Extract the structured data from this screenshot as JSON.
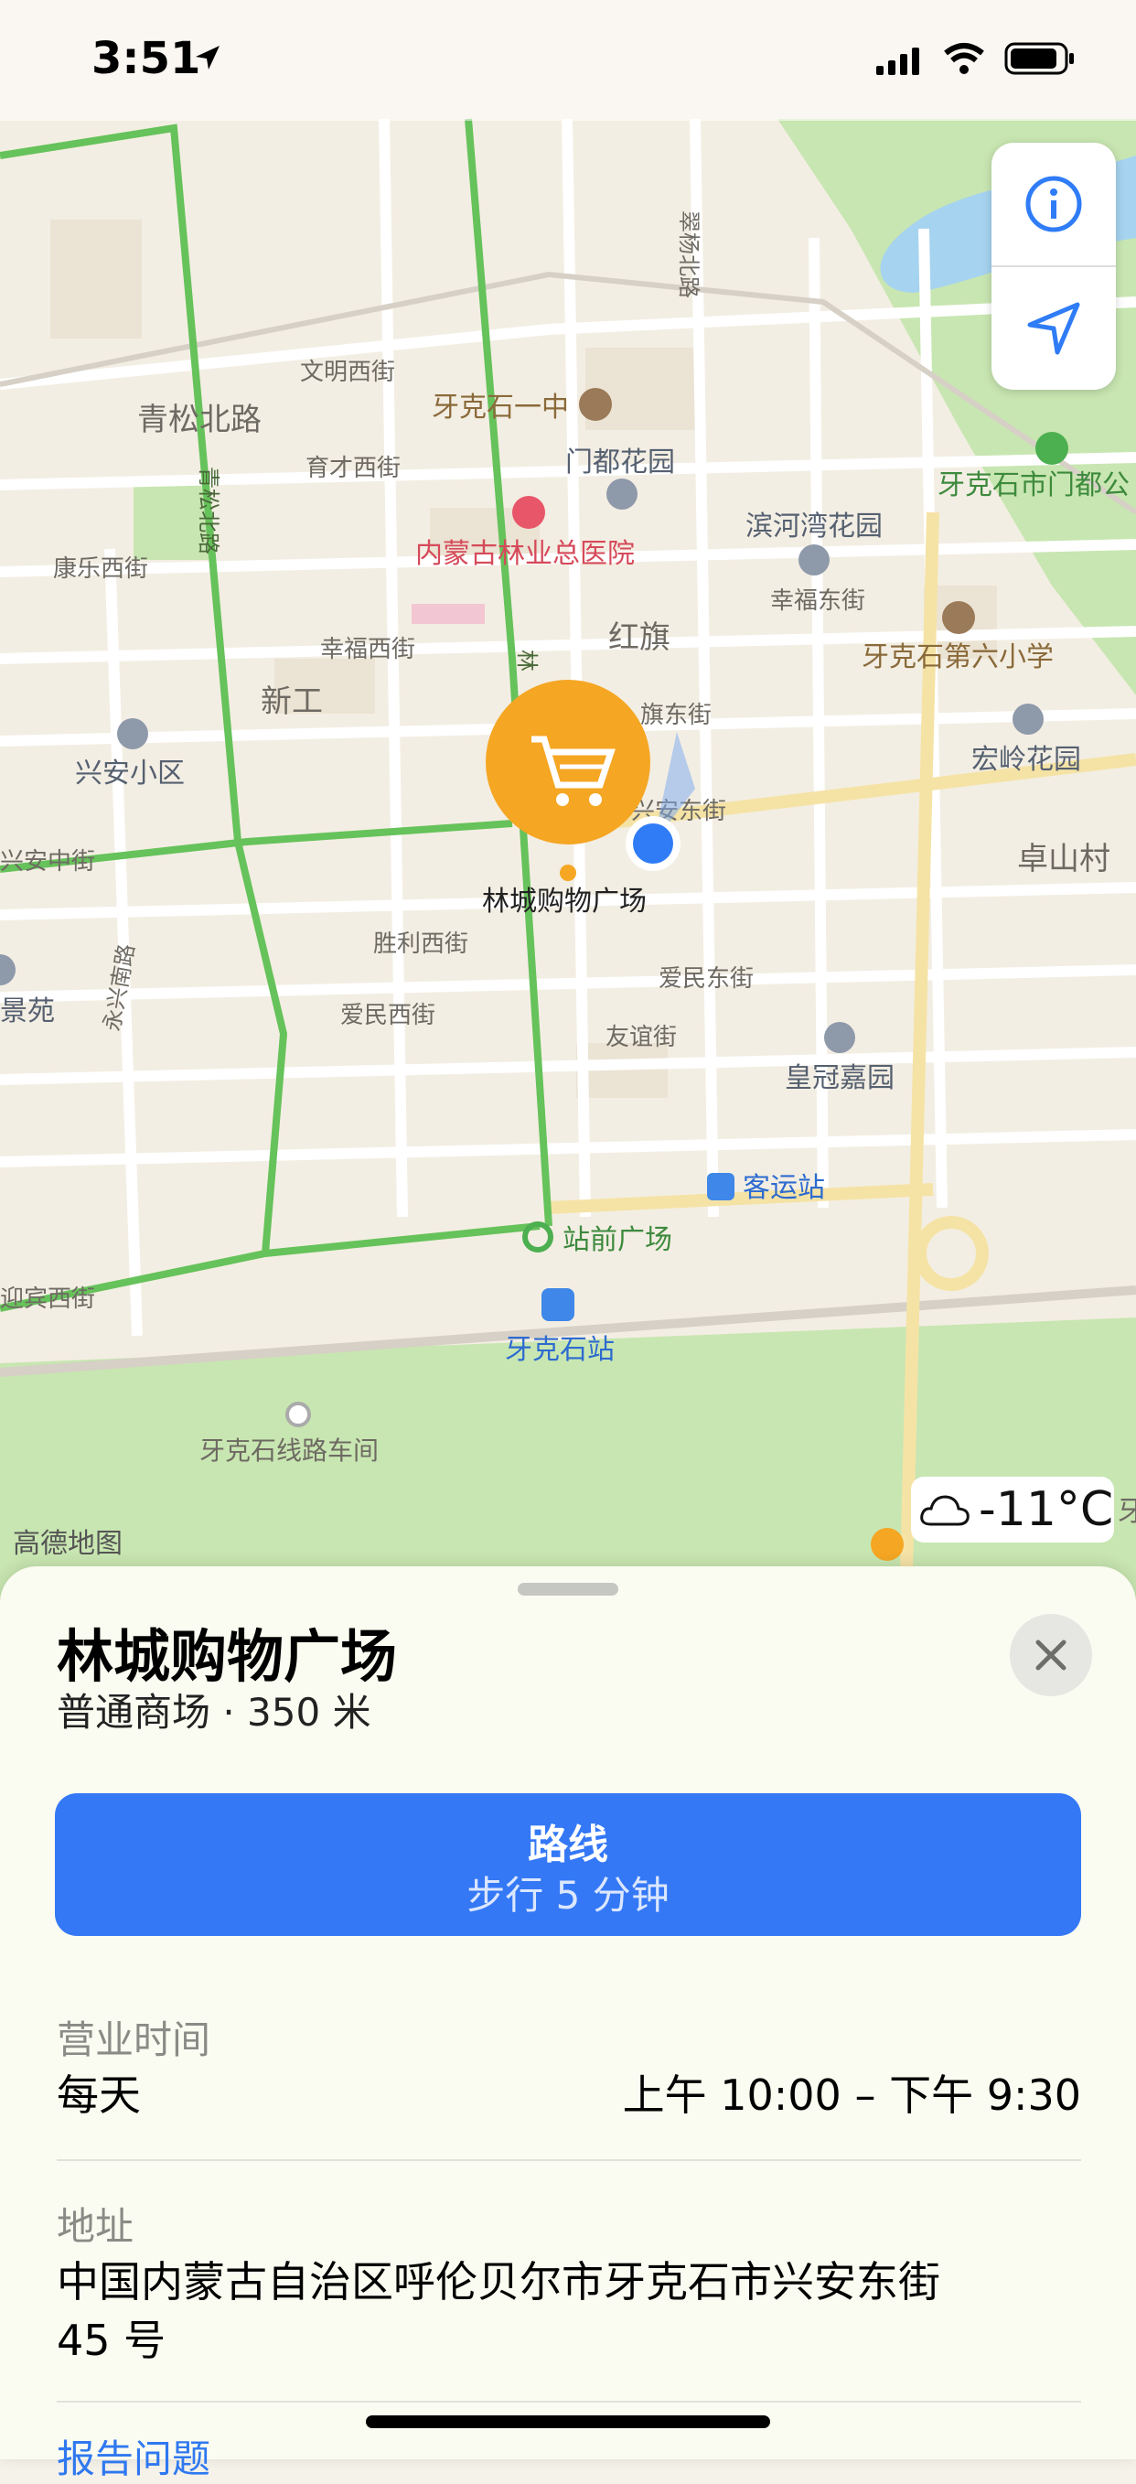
{
  "status_bar": {
    "time": "3:51"
  },
  "map": {
    "labels": {
      "cuiyang_bei_lu": "翠杨北路",
      "wenming_xi_jie": "文明西街",
      "qingsong_bei_lu_area": "青松北路",
      "qingsong_bei_lu_road": "青松北路",
      "yakeshi_yizhong": "牙克石一中",
      "yucai_xi_jie": "育才西街",
      "mendu_huayuan": "门都花园",
      "yakeshi_mendu_gongyuan": "牙克石市门都公",
      "kangle_xi_jie": "康乐西街",
      "forestry_hospital": "内蒙古林业总医院",
      "binhewan_huayuan": "滨河湾花园",
      "xingfu_dong_jie": "幸福东街",
      "xingfu_xi_jie": "幸福西街",
      "hongqi": "红旗",
      "yakeshi_no6_primary": "牙克石第六小学",
      "xingong": "新工",
      "lin_road": "林",
      "hongqi_dong_jie_partial": "旗东街",
      "xingan_xiaoqu": "兴安小区",
      "hongling_huayuan": "宏岭花园",
      "xingan_dong_jie": "兴安东街",
      "zhuoshan_cun": "卓山村",
      "xingan_zhong_jie": "兴安中街",
      "selected_place_pin": "林城购物广场",
      "shengli_xi_jie": "胜利西街",
      "aimin_dong_jie": "爱民东街",
      "jingyuan": "景苑",
      "aimin_xi_jie": "爱民西街",
      "youyi_jie": "友谊街",
      "yongxing_nan_lu": "永兴南路",
      "huangguan_jiayuan": "皇冠嘉园",
      "keyun_zhan": "客运站",
      "zhanqian_guangchang": "站前广场",
      "yingbin_xi_jie": "迎宾西街",
      "yakeshi_station": "牙克石站",
      "yakeshi_xianlu_chejian": "牙克石线路车间",
      "right_edge_partial": "牙"
    },
    "weather": {
      "temperature": "-11°C",
      "icon": "cloud-icon"
    },
    "attribution": "高德地图",
    "colors": {
      "land": "#f3eee3",
      "park": "#c8e6b1",
      "water": "#a6d3f0",
      "green_road": "#66c25a",
      "pin": "#f5a623",
      "user": "#2f7cf6"
    }
  },
  "sheet": {
    "title": "林城购物广场",
    "subtitle": "普通商场 · 350 米",
    "route_button": {
      "title": "路线",
      "subtitle": "步行 5 分钟"
    },
    "hours": {
      "label": "营业时间",
      "day": "每天",
      "time": "上午 10:00 – 下午 9:30"
    },
    "address": {
      "label": "地址",
      "line1": "中国内蒙古自治区呼伦贝尔市牙克石市兴安东街",
      "line2": "45 号"
    },
    "report_issue": "报告问题"
  }
}
